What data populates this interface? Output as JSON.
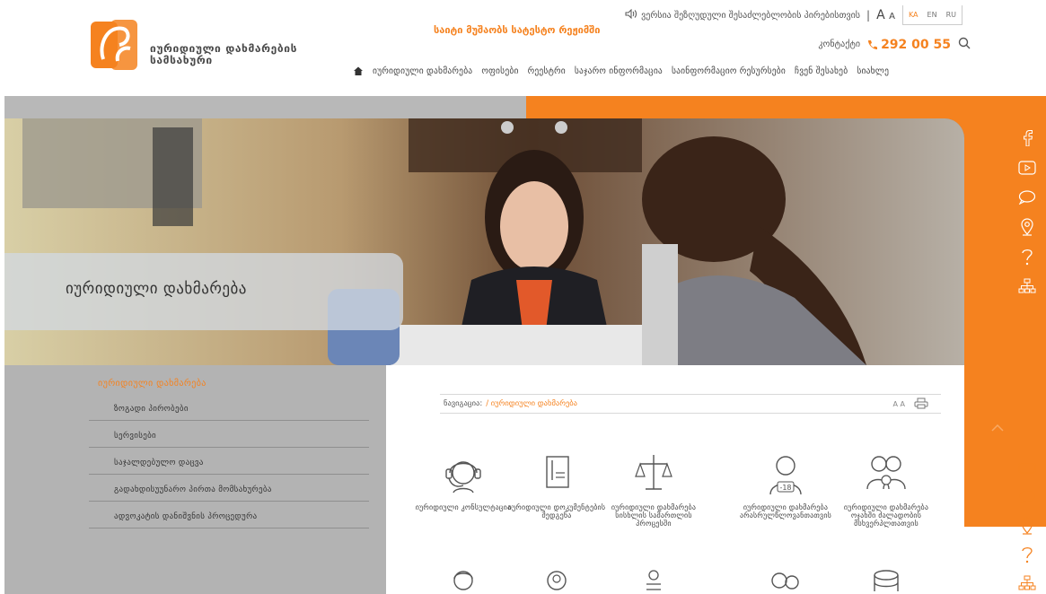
{
  "header": {
    "logo_text_line1": "იურიდიული დახმარების",
    "logo_text_line2": "სამსახური",
    "schedule": "საიტი მუშაობს სატესტო რეჟიმში",
    "accessibility_text": "ვერსია შეზღუდული შესაძლებლობის პირებისთვის",
    "font_big": "A",
    "font_small": "A",
    "langs": [
      "KA",
      "EN",
      "RU"
    ],
    "active_lang": "KA",
    "contact_label": "კონტაქტი",
    "phone": "292 00 55"
  },
  "nav": {
    "items": [
      "იურიდიული დახმარება",
      "ოფისები",
      "რეესტრი",
      "საჯარო ინფორმაცია",
      "საინფორმაციო რესურსები",
      "ჩვენ შესახებ",
      "სიახლე"
    ]
  },
  "hero": {
    "title": "იურიდიული დახმარება"
  },
  "sidebar": {
    "heading": "იურიდიული დახმარება",
    "items": [
      "ზოგადი პირობები",
      "სერვისები",
      "საჯალდებულო დაცვა",
      "გადახდისუუნარო პირთა მომსახურება",
      "ადვოკატის დანიშვნის პროცედურა"
    ]
  },
  "content": {
    "breadcrumb_label": "ნავიგაცია:",
    "breadcrumb_current": "/ იურიდიული დახმარება",
    "font_tool": "A A",
    "services": [
      {
        "label": "იურიდიული კონსულტაცია",
        "icon": "headset-icon"
      },
      {
        "label": "იურიდიული დოკუმენტების შედგენა",
        "icon": "document-icon"
      },
      {
        "label": "იურიდიული დახმარება სისხლის სამართლის პროცესში",
        "icon": "scales-icon"
      },
      {
        "label": "იურიდიული დახმარება არასრულწლოვანთათვის",
        "icon": "minor-icon"
      },
      {
        "label": "იურიდიული დახმარება ოჯახში ძალადობის მსხვერპლთათვის",
        "icon": "family-icon"
      }
    ]
  },
  "colors": {
    "accent": "#f5821f",
    "grey": "#b3b3b3"
  },
  "social": {
    "top": [
      "facebook-icon",
      "youtube-icon",
      "chat-icon",
      "location-icon",
      "question-icon",
      "sitemap-icon"
    ],
    "bottom": [
      "youtube-icon",
      "chat-icon",
      "location-icon",
      "question-icon",
      "sitemap-icon"
    ]
  }
}
